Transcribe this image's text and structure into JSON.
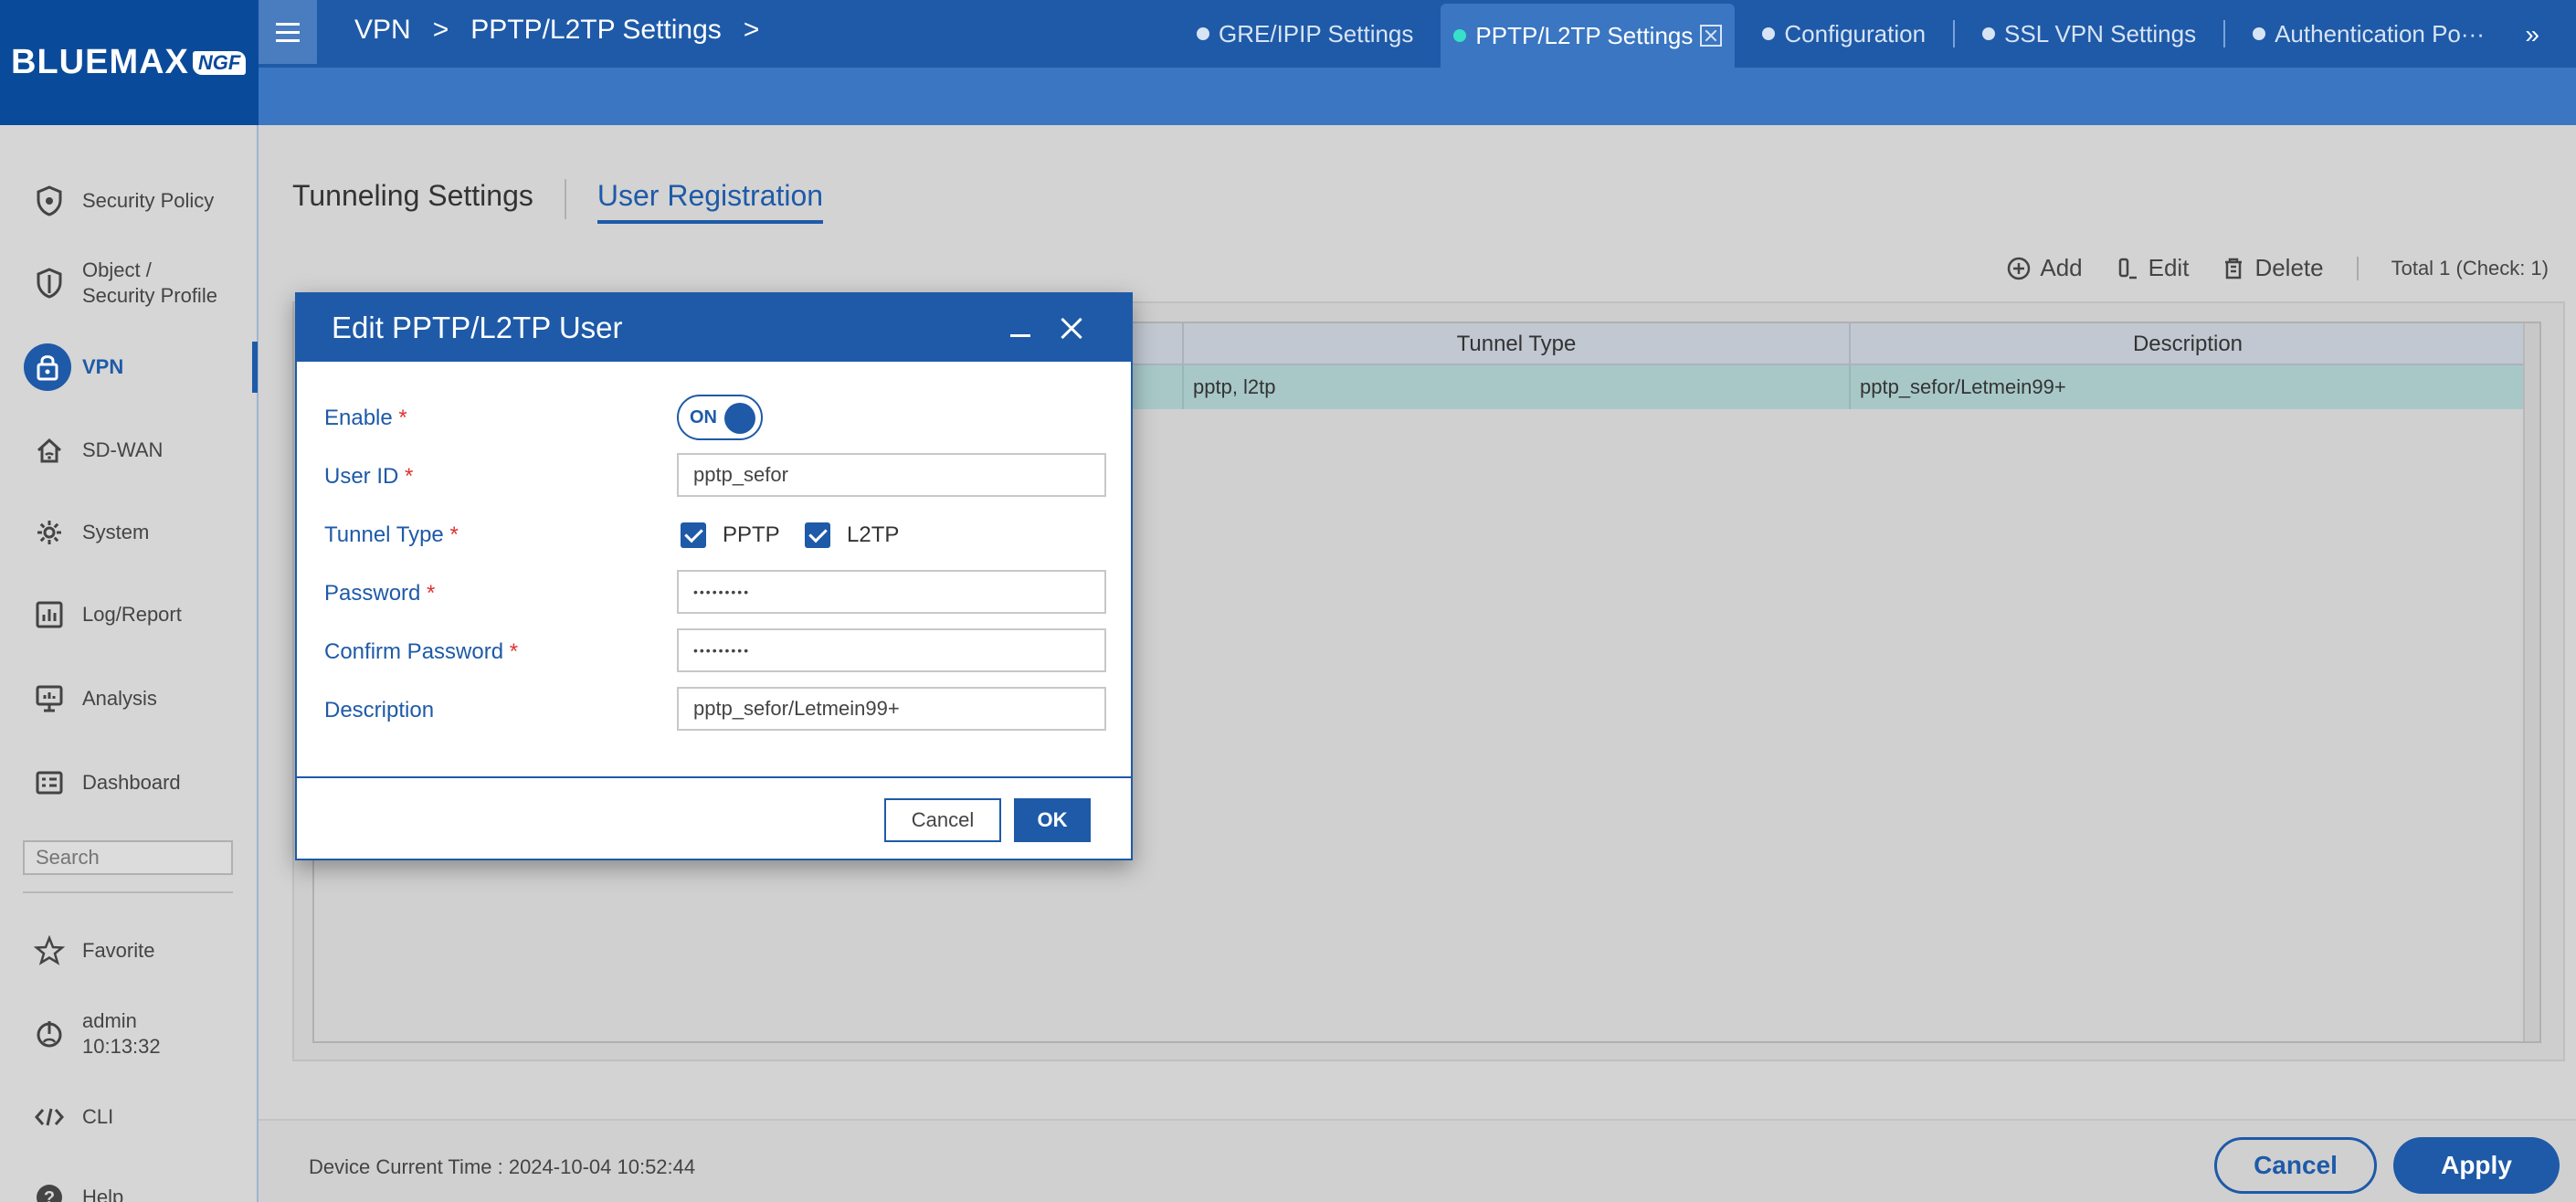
{
  "app": {
    "logo_text": "BLUEMAX",
    "logo_badge": "NGF"
  },
  "breadcrumb": {
    "items": [
      "VPN",
      "PPTP/L2TP Settings"
    ]
  },
  "tabs": [
    {
      "label": "GRE/IPIP Settings"
    },
    {
      "label": "PPTP/L2TP Settings",
      "active": true
    },
    {
      "label": "Configuration"
    },
    {
      "label": "SSL VPN Settings"
    },
    {
      "label": "Authentication Po···"
    }
  ],
  "tab_more": "»",
  "sidebar": {
    "items": [
      {
        "label": "Security Policy",
        "icon": "shield-icon"
      },
      {
        "label": "Object /\nSecurity Profile",
        "icon": "shield-icon"
      },
      {
        "label": "VPN",
        "icon": "lock-icon",
        "active": true
      },
      {
        "label": "SD-WAN",
        "icon": "home-wifi-icon"
      },
      {
        "label": "System",
        "icon": "gear-icon"
      },
      {
        "label": "Log/Report",
        "icon": "bar-chart-icon"
      },
      {
        "label": "Analysis",
        "icon": "monitor-icon"
      },
      {
        "label": "Dashboard",
        "icon": "dashboard-icon"
      }
    ],
    "search_placeholder": "Search",
    "bottom_items": [
      {
        "label": "Favorite",
        "icon": "star-icon"
      },
      {
        "label": "admin\n10:13:32",
        "icon": "power-icon"
      },
      {
        "label": "CLI",
        "icon": "code-icon"
      },
      {
        "label": "Help",
        "icon": "help-icon"
      }
    ]
  },
  "subtabs": [
    {
      "label": "Tunneling Settings"
    },
    {
      "label": "User Registration",
      "active": true
    }
  ],
  "toolbar": {
    "add": "Add",
    "edit": "Edit",
    "delete": "Delete",
    "total": "Total 1 (Check: 1)"
  },
  "table": {
    "columns": [
      "Tunnel Type",
      "Description"
    ],
    "rows": [
      {
        "tunnel_type": "pptp, l2tp",
        "description": "pptp_sefor/Letmein99+"
      }
    ]
  },
  "footer": {
    "device_time": "Device Current Time : 2024-10-04 10:52:44",
    "cancel": "Cancel",
    "apply": "Apply"
  },
  "modal": {
    "title": "Edit PPTP/L2TP User",
    "enable_label": "Enable",
    "enable_value": "ON",
    "user_id_label": "User ID",
    "user_id_value": "pptp_sefor",
    "tunnel_type_label": "Tunnel Type",
    "tunnel_pptp": "PPTP",
    "tunnel_l2tp": "L2TP",
    "password_label": "Password",
    "password_value": "•••••••••",
    "confirm_password_label": "Confirm Password",
    "confirm_password_value": "•••••••••",
    "description_label": "Description",
    "description_value": "pptp_sefor/Letmein99+",
    "cancel": "Cancel",
    "ok": "OK",
    "required_mark": "*"
  },
  "colors": {
    "primary": "#1e5aa8",
    "header_dark": "#0a4a9a",
    "active_tab_dot": "#37e0c8",
    "selected_row": "#a8c8c8",
    "required": "#d33333"
  }
}
